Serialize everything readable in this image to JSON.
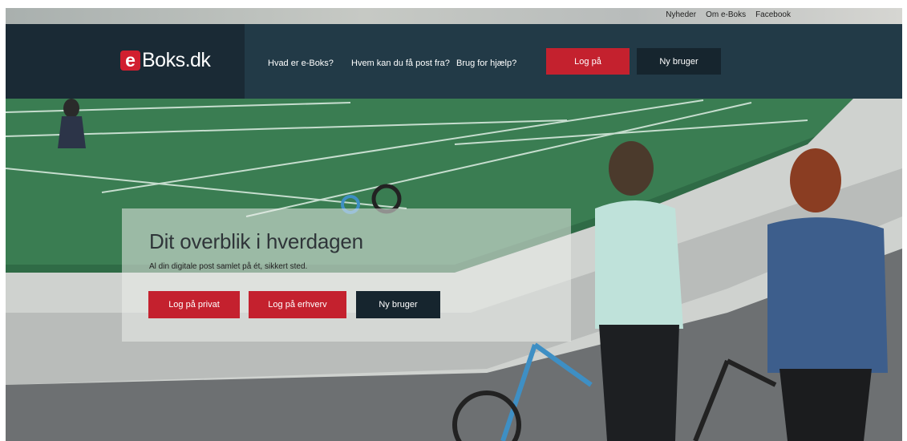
{
  "colors": {
    "brand_red": "#c4212e",
    "header_dark": "#1a2a35",
    "nav_bg": "#223a47",
    "button_dark": "#16252e"
  },
  "utility_nav": [
    "Nyheder",
    "Om e-Boks",
    "Facebook"
  ],
  "brand": {
    "logo_letter": "e",
    "logo_text": "Boks.dk"
  },
  "nav": {
    "links": [
      "Hvad er e-Boks?",
      "Hvem kan du få post fra?",
      "Brug for hjælp?"
    ],
    "login_label": "Log på",
    "new_user_label": "Ny bruger"
  },
  "hero": {
    "title": "Dit overblik i hverdagen",
    "subtitle": "Al din digitale post samlet på ét, sikkert sted.",
    "login_private_label": "Log på privat",
    "login_business_label": "Log på erhverv",
    "new_user_label": "Ny bruger"
  }
}
